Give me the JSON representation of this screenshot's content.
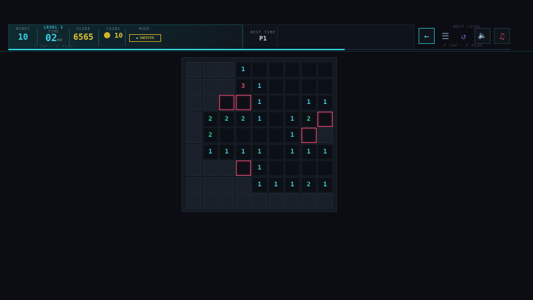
{
  "hud": {
    "mines": {
      "label": "MINES",
      "value": "10"
    },
    "level": {
      "label": "NEXT LEVEL",
      "value": "LEVEL 1"
    },
    "time": {
      "label": "TIME",
      "value": "02",
      "unit": "MIN"
    },
    "score": {
      "label": "SCORE",
      "value": "6565"
    },
    "coins": {
      "label": "COINS",
      "value": "10"
    },
    "mode": {
      "label": "MODE",
      "value": "SWEEPER"
    },
    "hints": "T TAP · F FLAG",
    "player": {
      "label": "BEST TIME",
      "value": "P1"
    },
    "right_level": "NEXT LEVEL",
    "right_hints": "T TAP · F FLAG",
    "progress_percent": 67,
    "colors": {
      "accent": "#2fd3e0",
      "flag": "#d14a6a",
      "gold": "#e0c23a"
    }
  },
  "controls": [
    {
      "name": "back-button",
      "icon": "arrow-left-icon",
      "glyph": "←"
    },
    {
      "name": "menu-button",
      "icon": "menu-icon",
      "glyph": "☰"
    },
    {
      "name": "restart-button",
      "icon": "restart-icon",
      "glyph": "↺"
    },
    {
      "name": "sound-button",
      "icon": "speaker-icon",
      "glyph": "🔈"
    },
    {
      "name": "music-button",
      "icon": "music-note-icon",
      "glyph": "♫"
    }
  ],
  "board": {
    "rows": [
      [
        "h",
        "h",
        "h",
        "1",
        "r",
        "r",
        "r",
        "r",
        "r"
      ],
      [
        "h",
        "h",
        "h",
        "3",
        "1",
        "r",
        "r",
        "r",
        "r"
      ],
      [
        "h",
        "h",
        "f",
        "f",
        "1",
        "r",
        "r",
        "1",
        "1"
      ],
      [
        "h",
        "2",
        "2",
        "2",
        "1",
        "r",
        "1",
        "2",
        "f"
      ],
      [
        "h",
        "2",
        "r",
        "r",
        "r",
        "r",
        "1",
        "f",
        "h"
      ],
      [
        "h",
        "1",
        "1",
        "1",
        "1",
        "r",
        "1",
        "1",
        "1"
      ],
      [
        "h",
        "h",
        "h",
        "f",
        "1",
        "r",
        "r",
        "r",
        "r"
      ],
      [
        "h",
        "h",
        "h",
        "h",
        "1",
        "1",
        "1",
        "2",
        "1"
      ],
      [
        "h",
        "h",
        "h",
        "h",
        "h",
        "h",
        "h",
        "h",
        "h"
      ]
    ]
  }
}
